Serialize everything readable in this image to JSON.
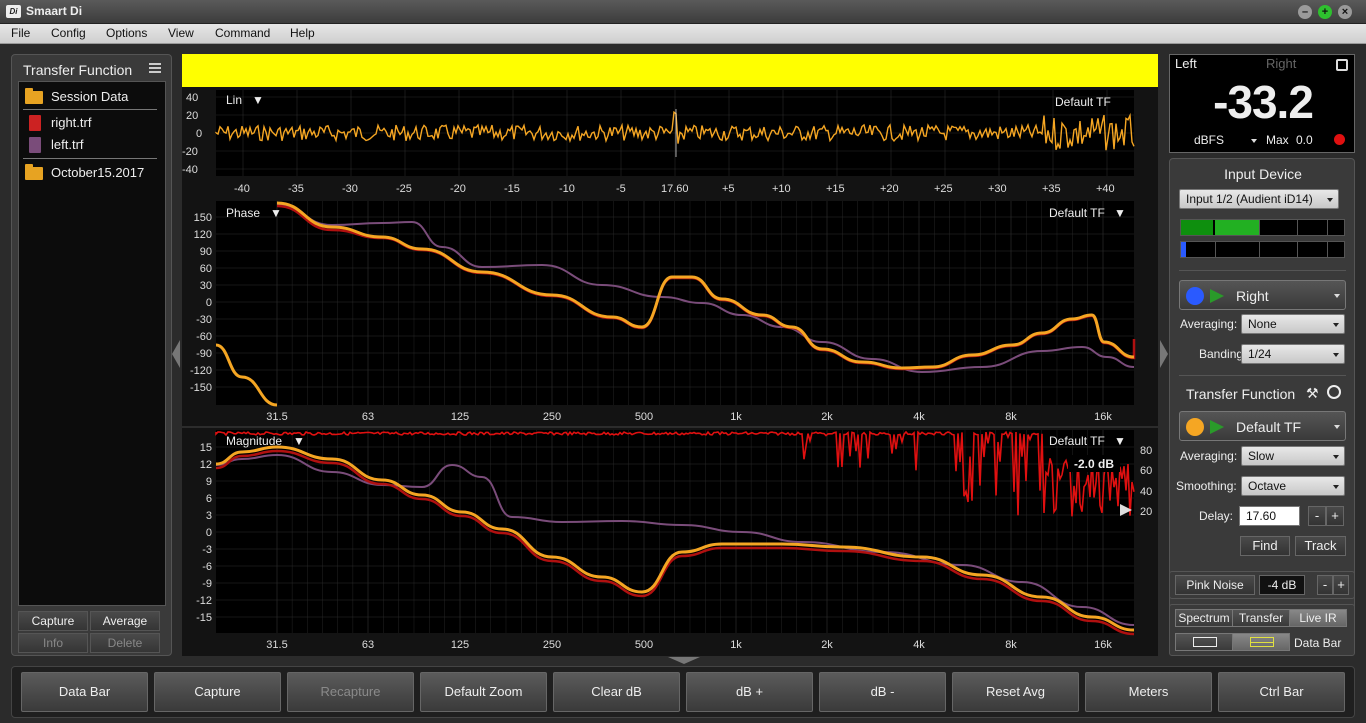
{
  "app": {
    "title": "Smaart Di",
    "logo_text": "Di"
  },
  "menu": [
    "File",
    "Config",
    "Options",
    "View",
    "Command",
    "Help"
  ],
  "left_panel": {
    "title": "Transfer Function",
    "items": [
      {
        "label": "Session Data",
        "icon": "folder-icon"
      },
      {
        "label": "right.trf",
        "icon": "file-icon",
        "color": "#cc2222"
      },
      {
        "label": "left.trf",
        "icon": "file-icon",
        "color": "#7a4c7a"
      },
      {
        "label": "October15.2017",
        "icon": "folder-icon"
      }
    ],
    "buttons": {
      "capture": "Capture",
      "average": "Average",
      "info": "Info",
      "delete": "Delete"
    }
  },
  "plots": {
    "live_ir": {
      "label": "Lin",
      "trace": "Default TF",
      "y_ticks": [
        "40",
        "20",
        "0",
        "-20",
        "-40"
      ],
      "x_ticks": [
        "-40",
        "-35",
        "-30",
        "-25",
        "-20",
        "-15",
        "-10",
        "-5",
        "17.60",
        "+5",
        "+10",
        "+15",
        "+20",
        "+25",
        "+30",
        "+35",
        "+40"
      ]
    },
    "phase": {
      "label": "Phase",
      "trace": "Default TF",
      "y_ticks": [
        "150",
        "120",
        "90",
        "60",
        "30",
        "0",
        "-30",
        "-60",
        "-90",
        "-120",
        "-150"
      ],
      "x_ticks": [
        "31.5",
        "63",
        "125",
        "250",
        "500",
        "1k",
        "2k",
        "4k",
        "8k",
        "16k"
      ]
    },
    "magnitude": {
      "label": "Magnitude",
      "trace": "Default TF",
      "y_ticks": [
        "15",
        "12",
        "9",
        "6",
        "3",
        "0",
        "-3",
        "-6",
        "-9",
        "-12",
        "-15"
      ],
      "coherence_ticks": [
        "80",
        "60",
        "40",
        "20"
      ],
      "readout": "-2.0 dB",
      "x_ticks": [
        "31.5",
        "63",
        "125",
        "250",
        "500",
        "1k",
        "2k",
        "4k",
        "8k",
        "16k"
      ]
    },
    "colors": {
      "tf": "#f5a623",
      "right": "#b01010",
      "left": "#7a4c7a",
      "coherence": "#e01010"
    }
  },
  "meter": {
    "left_label": "Left",
    "right_label": "Right",
    "value": "-33.2",
    "unit": "dBFS",
    "max_label": "Max",
    "max_value": "0.0"
  },
  "input": {
    "title": "Input Device",
    "device": "Input 1/2 (Audient iD14)",
    "signal_name": "Right",
    "averaging_label": "Averaging:",
    "averaging": "None",
    "banding_label": "Banding:",
    "banding": "1/24"
  },
  "transfer": {
    "title": "Transfer Function",
    "name": "Default TF",
    "averaging_label": "Averaging:",
    "averaging": "Slow",
    "smoothing_label": "Smoothing:",
    "smoothing": "Octave",
    "delay_label": "Delay:",
    "delay": "17.60",
    "minus": "-",
    "plus": "+",
    "find": "Find",
    "track": "Track"
  },
  "noise": {
    "label": "Pink Noise",
    "level": "-4 dB",
    "minus": "-",
    "plus": "+"
  },
  "modes": {
    "spectrum": "Spectrum",
    "transfer": "Transfer",
    "live_ir": "Live IR",
    "data_bar": "Data Bar"
  },
  "bottom_bar": [
    "Data Bar",
    "Capture",
    "Recapture",
    "Default Zoom",
    "Clear dB",
    "dB +",
    "dB -",
    "Reset Avg",
    "Meters",
    "Ctrl Bar"
  ]
}
